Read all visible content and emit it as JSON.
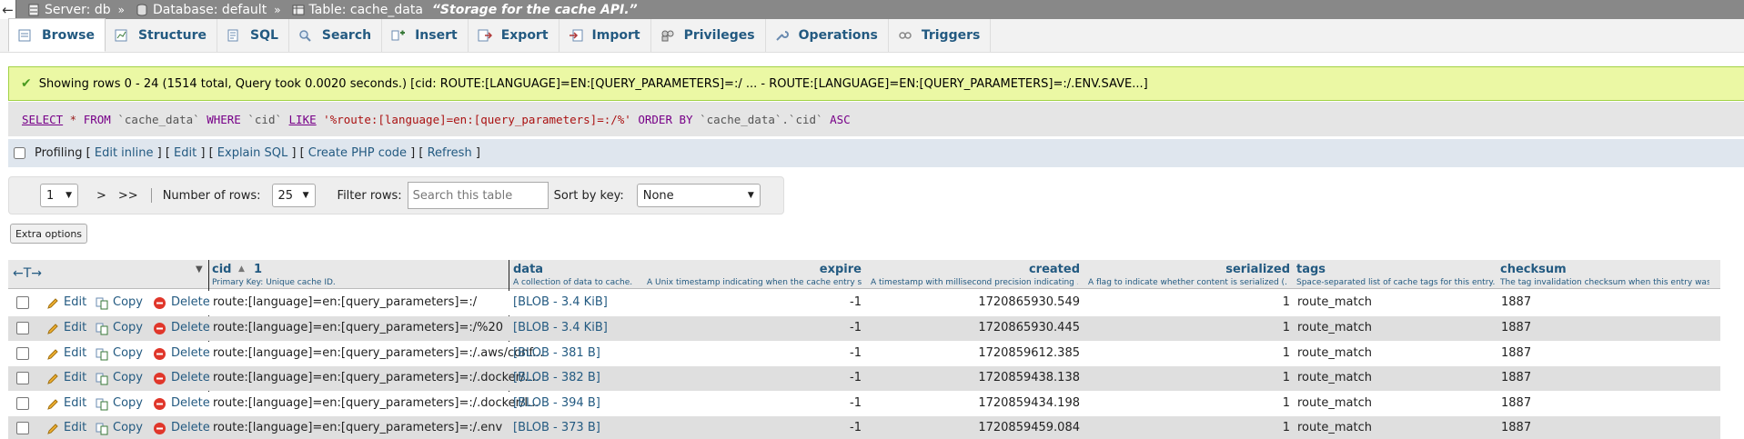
{
  "breadcrumb": {
    "back_icon": "←",
    "server": "Server: db",
    "database": "Database: default",
    "table": "Table: cache_data",
    "comment": "“Storage for the cache API.”",
    "separator": "»"
  },
  "tabs": [
    {
      "label": "Browse",
      "icon": "browse-icon"
    },
    {
      "label": "Structure",
      "icon": "structure-icon"
    },
    {
      "label": "SQL",
      "icon": "sql-icon"
    },
    {
      "label": "Search",
      "icon": "search-icon"
    },
    {
      "label": "Insert",
      "icon": "insert-icon"
    },
    {
      "label": "Export",
      "icon": "export-icon"
    },
    {
      "label": "Import",
      "icon": "import-icon"
    },
    {
      "label": "Privileges",
      "icon": "privileges-icon"
    },
    {
      "label": "Operations",
      "icon": "operations-icon"
    },
    {
      "label": "Triggers",
      "icon": "triggers-icon"
    }
  ],
  "message": {
    "text": "Showing rows 0 - 24 (1514 total, Query took 0.0020 seconds.) [cid: ROUTE:[LANGUAGE]=EN:[QUERY_PARAMETERS]=:/ ... - ROUTE:[LANGUAGE]=EN:[QUERY_PARAMETERS]=:/.ENV.SAVE...]"
  },
  "sql": {
    "select": "SELECT",
    "star": " * ",
    "from": "FROM",
    "table": " `cache_data` ",
    "where": "WHERE",
    "col": " `cid` ",
    "like": "LIKE",
    "pattern": " '%route:[language]=en:[query_parameters]=:/%' ",
    "order": "ORDER BY",
    "ordercol": " `cache_data`.`cid` ",
    "asc": "ASC"
  },
  "profiling": {
    "label": "Profiling",
    "open": " [ ",
    "edit_inline": "Edit inline",
    "mid1": " ] [ ",
    "edit": "Edit",
    "mid2": " ] [ ",
    "explain": "Explain SQL",
    "mid3": " ] [ ",
    "create_php": "Create PHP code",
    "mid4": " ] [ ",
    "refresh": "Refresh",
    "close": " ]"
  },
  "navigation": {
    "page_value": "1",
    "next": ">",
    "last": ">>",
    "rows_label": "Number of rows:",
    "rows_value": "25",
    "filter_label": "Filter rows:",
    "filter_placeholder": "Search this table",
    "sort_label": "Sort by key:",
    "sort_value": "None"
  },
  "extra_options": "Extra options",
  "table": {
    "arrows": "←T→",
    "sort_indicator": "▲",
    "sort_order": "1",
    "columns": [
      {
        "name": "cid",
        "desc": "Primary Key: Unique cache ID."
      },
      {
        "name": "data",
        "desc": "A collection of data to cache."
      },
      {
        "name": "expire",
        "desc": "A Unix timestamp indicating when the cache entry s..."
      },
      {
        "name": "created",
        "desc": "A timestamp with millisecond precision indicating ..."
      },
      {
        "name": "serialized",
        "desc": "A flag to indicate whether content is serialized (..."
      },
      {
        "name": "tags",
        "desc": "Space-separated list of cache tags for this entry."
      },
      {
        "name": "checksum",
        "desc": "The tag invalidation checksum when this entry was ..."
      }
    ],
    "actions": {
      "edit": "Edit",
      "copy": "Copy",
      "delete": "Delete"
    },
    "rows": [
      {
        "cid": "route:[language]=en:[query_parameters]=:/",
        "data": "[BLOB - 3.4 KiB]",
        "expire": "-1",
        "created": "1720865930.549",
        "serialized": "1",
        "tags": "route_match",
        "checksum": "1887"
      },
      {
        "cid": "route:[language]=en:[query_parameters]=:/%20",
        "data": "[BLOB - 3.4 KiB]",
        "expire": "-1",
        "created": "1720865930.445",
        "serialized": "1",
        "tags": "route_match",
        "checksum": "1887"
      },
      {
        "cid": "route:[language]=en:[query_parameters]=:/.aws/conf...",
        "data": "[BLOB - 381 B]",
        "expire": "-1",
        "created": "1720859612.385",
        "serialized": "1",
        "tags": "route_match",
        "checksum": "1887"
      },
      {
        "cid": "route:[language]=en:[query_parameters]=:/.docker/....",
        "data": "[BLOB - 382 B]",
        "expire": "-1",
        "created": "1720859438.138",
        "serialized": "1",
        "tags": "route_match",
        "checksum": "1887"
      },
      {
        "cid": "route:[language]=en:[query_parameters]=:/.docker/l...",
        "data": "[BLOB - 394 B]",
        "expire": "-1",
        "created": "1720859434.198",
        "serialized": "1",
        "tags": "route_match",
        "checksum": "1887"
      },
      {
        "cid": "route:[language]=en:[query_parameters]=:/.env",
        "data": "[BLOB - 373 B]",
        "expire": "-1",
        "created": "1720859459.084",
        "serialized": "1",
        "tags": "route_match",
        "checksum": "1887"
      }
    ]
  },
  "colors": {
    "link": "#235a81",
    "success_bg": "#ebf8a4",
    "delete_icon": "#e0362a"
  }
}
